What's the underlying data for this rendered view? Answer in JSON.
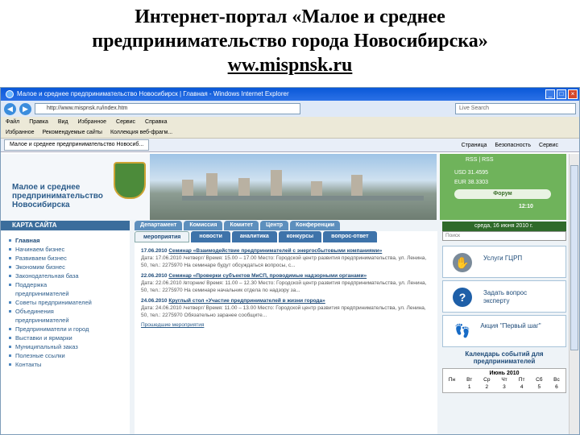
{
  "slide": {
    "title_line1": "Интернет-портал «Малое и среднее",
    "title_line2": "предпринимательство города Новосибирска»",
    "url": "ww.mispnsk.ru"
  },
  "browser": {
    "window_title": "Малое и среднее предпринимательство Новосибирск | Главная - Windows Internet Explorer",
    "address": "http://www.mispnsk.ru/index.htm",
    "search_placeholder": "Live Search",
    "menu": [
      "Файл",
      "Правка",
      "Вид",
      "Избранное",
      "Сервис",
      "Справка"
    ],
    "favorites": [
      "Избранное",
      "Рекомендуемые сайты",
      "Коллекция веб-фрагм..."
    ],
    "tab_title": "Малое и среднее предпринимательство Новосиб...",
    "commands": [
      "Страница",
      "Безопасность",
      "Сервис"
    ]
  },
  "site": {
    "logo_text": "Малое и среднее предпринимательство Новосибирска",
    "rss": "RSS | RSS",
    "usd": "USD 31.4595",
    "eur": "EUR 38.3303",
    "forum_label": "Форум",
    "time": "12:10",
    "date": "среда, 16 июня 2010 г.",
    "sitemap_label": "КАРТА САЙТА",
    "topnav": [
      "Департамент",
      "Комиссия",
      "Комитет",
      "Центр",
      "Конференции"
    ],
    "subtabs": [
      "мероприятия",
      "новости",
      "аналитика",
      "конкурсы",
      "вопрос-ответ"
    ],
    "sidebar": [
      "Главная",
      "Начинаем бизнес",
      "Развиваем бизнес",
      "Экономим бизнес",
      "Законодательная база",
      "Поддержка предпринимателей",
      "Советы предпринимателей",
      "Объединения предпринимателей",
      "Предприниматели и город",
      "Выставки и ярмарки",
      "Муниципальный заказ",
      "Полезные ссылки",
      "Контакты"
    ],
    "events": [
      {
        "date": "17.06.2010",
        "title": "Семинар «Взаимодействие предпринимателей с энергосбытовыми компаниями»",
        "body": "Дата: 17.06.2010 /четверг/ Время: 15.00 – 17.00 Место: Городской центр развития предпринимательства, ул. Ленина, 50, тел.: 2275970 На семинаре будут обсуждаться вопросы, с..."
      },
      {
        "date": "22.06.2010",
        "title": "Семинар «Проверки субъектов МиСП, проводимые надзорными органами»",
        "body": "Дата: 22.06.2010 /вторник/ Время: 11.00 – 12.30 Место: Городской центр развития предпринимательства, ул. Ленина, 50, тел.: 2275970 На семинаре начальник отдела по надзору за..."
      },
      {
        "date": "24.06.2010",
        "title": "Круглый стол «Участие предпринимателей в жизни города»",
        "body": "Дата: 24.06.2010 /четверг/ Время: 11.00 – 13.00 Место: Городской центр развития предпринимательства, ул. Ленина, 50, тел.: 2275970 Обязательно заранее сообщите..."
      }
    ],
    "prev_events": "Прошедшие мероприятия",
    "right_search": "Поиск",
    "right_buttons": [
      "Услуги ГЦРП",
      "Задать вопрос эксперту",
      "Акция \"Первый шаг\""
    ],
    "calendar_header": "Календарь событий для предпринимателей",
    "calendar_month": "Июнь 2010",
    "calendar_days": [
      "Пн",
      "Вт",
      "Ср",
      "Чт",
      "Пт",
      "Сб",
      "Вс"
    ],
    "calendar_row1": [
      "",
      "1",
      "2",
      "3",
      "4",
      "5",
      "6"
    ]
  }
}
